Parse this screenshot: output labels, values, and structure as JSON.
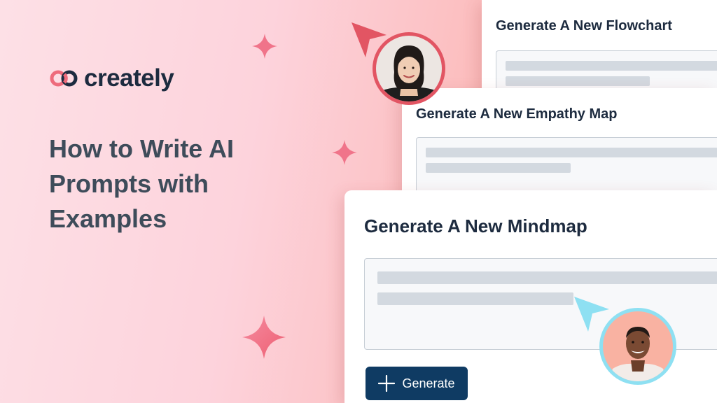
{
  "brand": {
    "name": "creately",
    "colors": {
      "mark_left": "#ee6b7c",
      "mark_right": "#1d2b3f",
      "text": "#1d2b3f"
    }
  },
  "headline": "How to Write AI Prompts with Examples",
  "cards": {
    "flowchart": {
      "title": "Generate A New Flowchart"
    },
    "empathy": {
      "title": "Generate A New Empathy Map"
    },
    "mindmap": {
      "title": "Generate A New Mindmap",
      "button_label": "Generate",
      "button_icon": "plus-icon"
    }
  },
  "collaborators": [
    {
      "name": "avatar-woman",
      "ring_color": "#e25563",
      "cursor_color": "#e25563"
    },
    {
      "name": "avatar-man",
      "ring_color": "#8ee0f2",
      "cursor_color": "#8ee0f2"
    }
  ],
  "colors": {
    "accent_button": "#0f3b63",
    "placeholder_bar": "#d3d9e0",
    "sparkle": "#f0748a"
  }
}
